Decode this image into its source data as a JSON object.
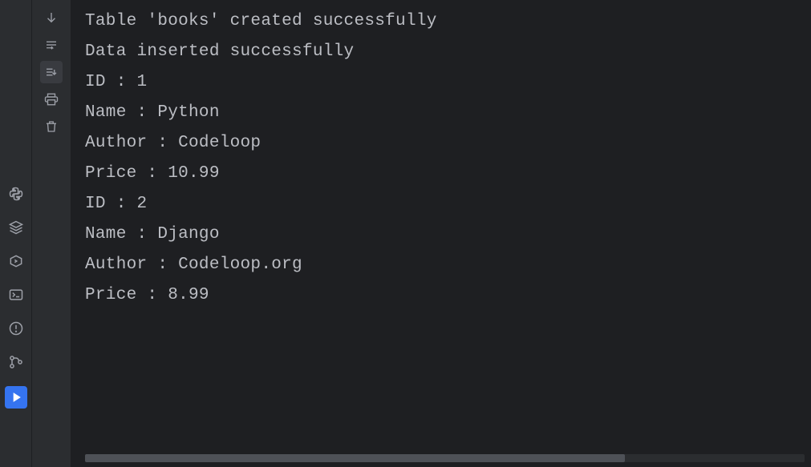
{
  "console": {
    "lines": [
      "Table 'books' created successfully",
      "Data inserted successfully",
      "ID : 1",
      "Name : Python",
      "Author : Codeloop",
      "Price : 10.99",
      "",
      "ID : 2",
      "Name : Django",
      "Author : Codeloop.org",
      "Price : 8.99"
    ]
  }
}
